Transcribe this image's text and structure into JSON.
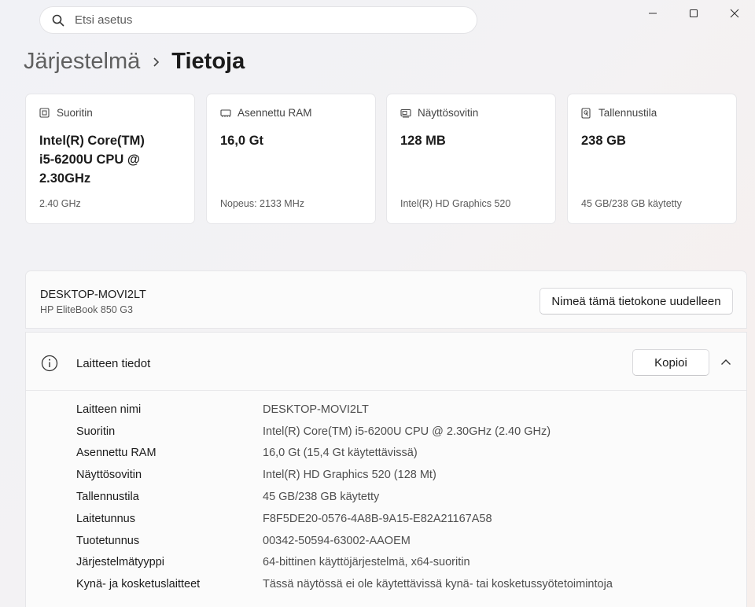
{
  "search": {
    "placeholder": "Etsi asetus"
  },
  "breadcrumb": {
    "parent": "Järjestelmä",
    "current": "Tietoja"
  },
  "cards": [
    {
      "label": "Suoritin",
      "value": "Intel(R) Core(TM) i5-6200U CPU @ 2.30GHz",
      "sub": "2.40 GHz",
      "icon": "processor-icon"
    },
    {
      "label": "Asennettu RAM",
      "value": "16,0 Gt",
      "sub": "Nopeus: 2133 MHz",
      "icon": "ram-icon"
    },
    {
      "label": "Näyttösovitin",
      "value": "128 MB",
      "sub": "Intel(R) HD Graphics 520",
      "icon": "display-adapter-icon"
    },
    {
      "label": "Tallennustila",
      "value": "238 GB",
      "sub": "45 GB/238 GB käytetty",
      "icon": "storage-icon"
    }
  ],
  "device": {
    "name": "DESKTOP-MOVI2LT",
    "model": "HP EliteBook 850 G3",
    "rename_label": "Nimeä tämä tietokone uudelleen"
  },
  "specs": {
    "title": "Laitteen tiedot",
    "copy_label": "Kopioi",
    "rows": [
      {
        "key": "Laitteen nimi",
        "value": "DESKTOP-MOVI2LT"
      },
      {
        "key": "Suoritin",
        "value": "Intel(R) Core(TM) i5-6200U CPU @ 2.30GHz (2.40 GHz)"
      },
      {
        "key": "Asennettu RAM",
        "value": "16,0 Gt (15,4 Gt käytettävissä)"
      },
      {
        "key": "Näyttösovitin",
        "value": "Intel(R) HD Graphics 520 (128 Mt)"
      },
      {
        "key": "Tallennustila",
        "value": "45 GB/238 GB käytetty"
      },
      {
        "key": "Laitetunnus",
        "value": "F8F5DE20-0576-4A8B-9A15-E82A21167A58"
      },
      {
        "key": "Tuotetunnus",
        "value": "00342-50594-63002-AAOEM"
      },
      {
        "key": "Järjestelmätyyppi",
        "value": "64-bittinen käyttöjärjestelmä, x64-suoritin"
      },
      {
        "key": "Kynä- ja kosketuslaitteet",
        "value": "Tässä näytössä ei ole käytettävissä kynä- tai kosketussyötetoimintoja"
      }
    ]
  }
}
